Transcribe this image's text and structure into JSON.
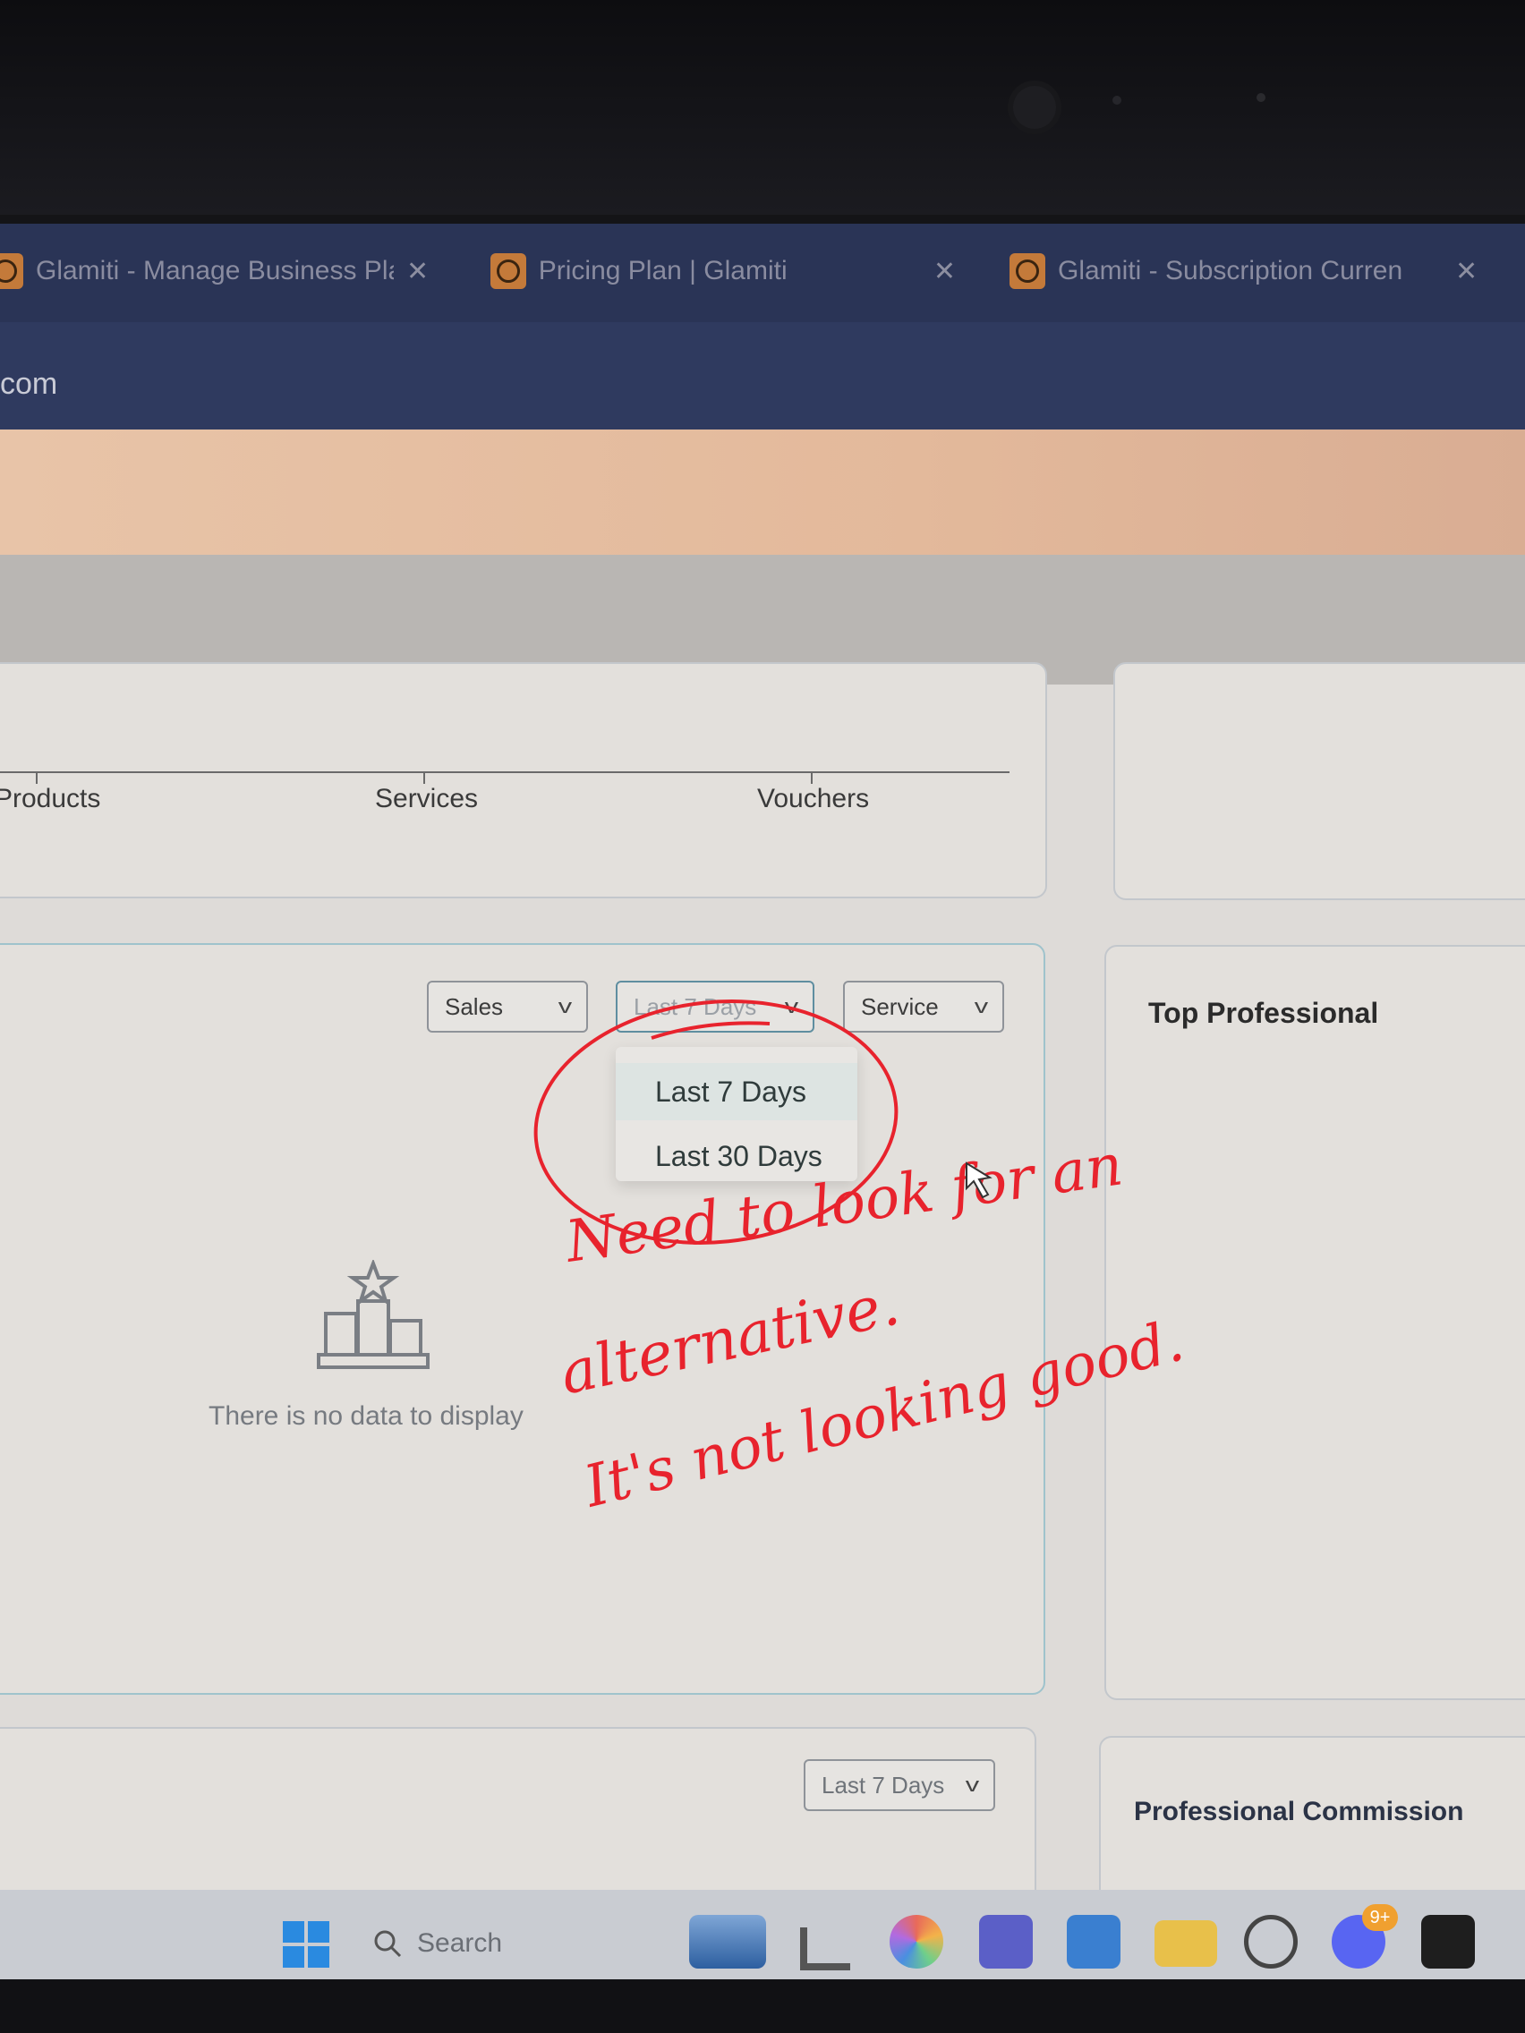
{
  "browser": {
    "tabs": [
      {
        "title": "Glamiti - Manage Business Plan"
      },
      {
        "title": "Pricing Plan | Glamiti"
      },
      {
        "title": "Glamiti - Subscription Curren"
      }
    ],
    "address": "com"
  },
  "sales_chart": {
    "categories": [
      "Products",
      "Services",
      "Vouchers"
    ]
  },
  "filters": {
    "metric": "Sales",
    "period": "Last 7 Days",
    "type": "Service",
    "period_options": [
      "Last 7 Days",
      "Last 30 Days"
    ]
  },
  "top_professional": {
    "title": "Top Professional",
    "empty_message": "There is no data to display"
  },
  "commission": {
    "period": "Last 7 Days",
    "title": "Professional Commission"
  },
  "taskbar": {
    "search_label": "Search",
    "chat_badge": "9+"
  },
  "annotation": {
    "line1": "Need to look for an",
    "line2": "alternative.",
    "line3": "It's not looking good."
  },
  "colors": {
    "annotation": "#e8232d",
    "brand": "#c47a3a",
    "tabbar": "#2a3456"
  }
}
